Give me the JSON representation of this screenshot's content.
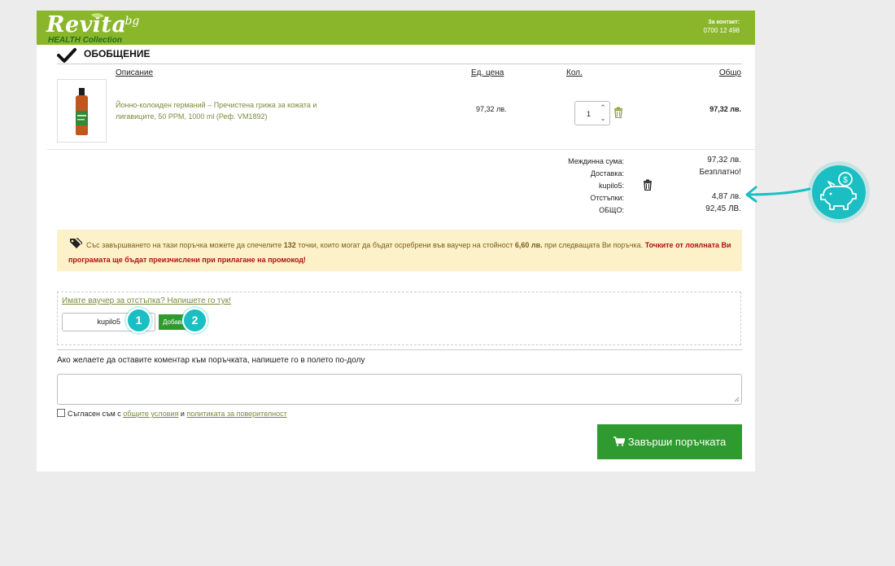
{
  "header": {
    "logo_main": "Revita",
    "logo_tld": ".bg",
    "logo_sub": "HEALTH Collection",
    "contact_label": "За контакт:",
    "contact_phone": "0700 12 498",
    "color": "#8ab62b"
  },
  "summary": {
    "title": "ОБОБЩЕНИЕ",
    "columns": {
      "description": "Описание",
      "unit_price": "Ед. цена",
      "qty": "Кол.",
      "total": "Общо"
    },
    "item": {
      "description": "Йонно-колоиден германий – Пречистена грижа за кожата и лигавиците, 50 PPM, 1000 ml (Реф. VM1892)",
      "unit_price": "97,32 лв.",
      "qty": "1",
      "total": "97,32 лв."
    }
  },
  "totals": {
    "subtotal_label": "Междинна сума:",
    "subtotal_value": "97,32 лв.",
    "shipping_label": "Доставка:",
    "shipping_value": "Безплатно!",
    "coupon_label": "kupilo5:",
    "discounts_label": "Отстъпки:",
    "discounts_value": "4,87 лв.",
    "grand_label": "ОБЩО:",
    "grand_value": "92,45 ЛВ."
  },
  "loyalty": {
    "part1": "Със завършването на тази поръчка можете да спечелите ",
    "points": "132",
    "part2": " точки, които могат да бъдат осребрени във ваучер на стойност ",
    "amount": "6,60 лв.",
    "part3": " при следващата Ви поръчка. ",
    "warning": "Точките от лоялната Ви програмата ще бъдат преизчислени при прилагане на промокод!"
  },
  "voucher": {
    "link": "Имате ваучер за отстъпка? Напишете го тук!",
    "code": "kupilo5",
    "button": "Добави"
  },
  "markers": {
    "step1": "1",
    "step2": "2"
  },
  "comment": {
    "label": "Ако желаете да оставите коментар към поръчката, напишете го в полето по-долу"
  },
  "agree": {
    "prefix": "Съгласен съм с ",
    "terms": "общите условия",
    "and": " и ",
    "privacy": "политиката за поверителност"
  },
  "checkout": {
    "button": "Завърши поръчката",
    "color": "#2f9a2f"
  },
  "annotation": {
    "icon": "piggy-bank-coin-icon",
    "color": "#1bbfc3"
  }
}
